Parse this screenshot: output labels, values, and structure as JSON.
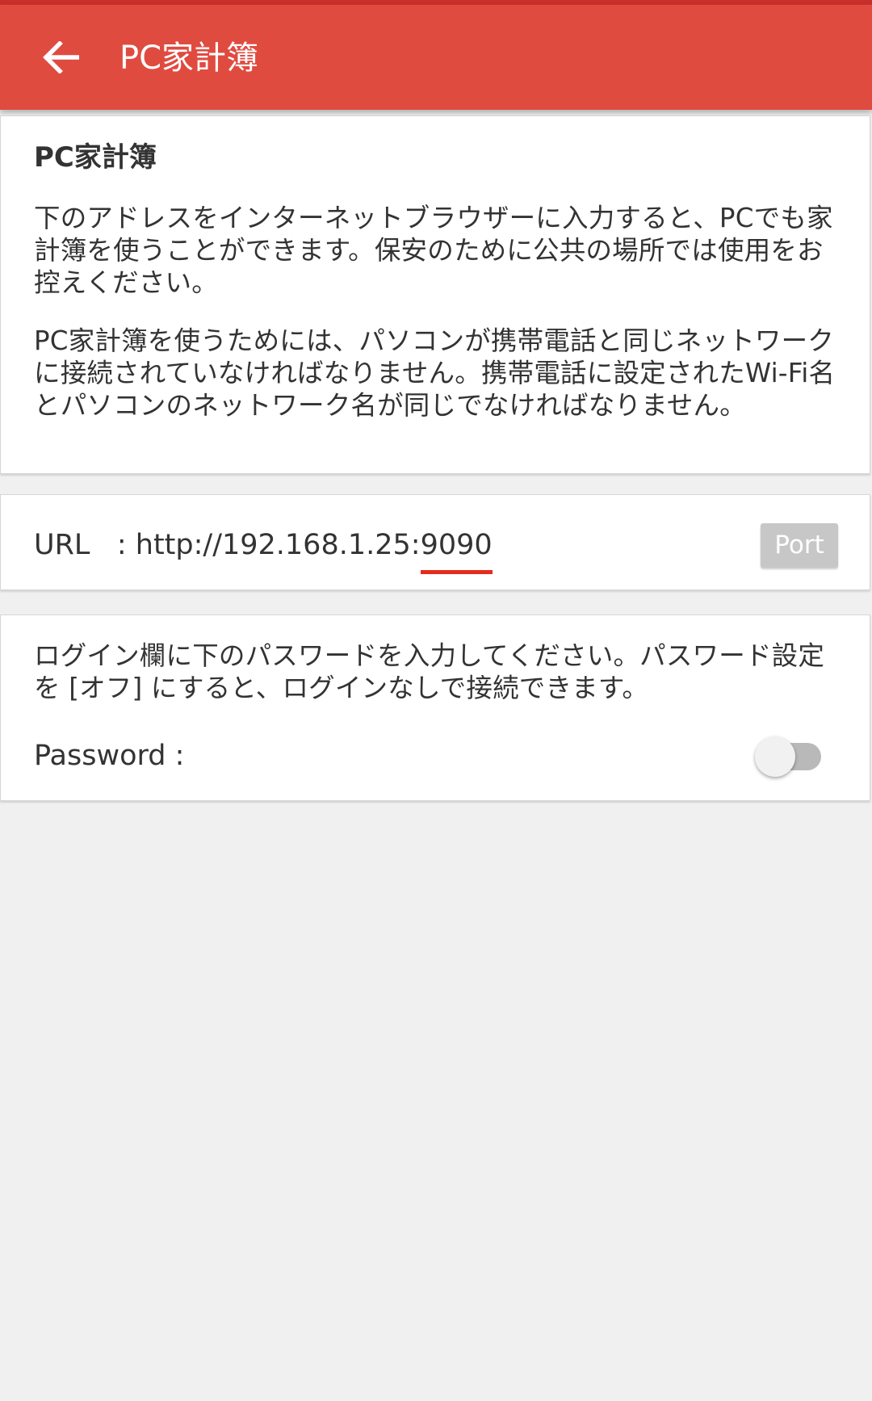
{
  "colors": {
    "appbar": "#e04b40",
    "status_strip": "#c9302b",
    "background": "#f0f0f0",
    "card": "#ffffff",
    "accent_underline": "#e62b1e",
    "port_button": "#c7c7c7",
    "toggle_track": "#b9b9b9",
    "toggle_thumb": "#f1f1f1"
  },
  "appbar": {
    "back_icon": "arrow-left-icon",
    "title": "PC家計簿"
  },
  "intro_card": {
    "title": "PC家計簿",
    "paragraph1": "下のアドレスをインターネットブラウザーに入力すると、PCでも家計簿を使うことができます。保安のために公共の場所では使用をお控えください。",
    "paragraph2": "PC家計簿を使うためには、パソコンが携帯電話と同じネットワークに接続されていなければなりません。携帯電話に設定されたWi-Fi名とパソコンのネットワーク名が同じでなければなりません。"
  },
  "url_card": {
    "label": "URL",
    "separator": ":",
    "base": "http://192.168.1.25:",
    "port": "9090",
    "port_button": "Port"
  },
  "password_card": {
    "description": "ログイン欄に下のパスワードを入力してください。パスワード設定を [オフ] にすると、ログインなしで接続できます。",
    "label": "Password :",
    "toggle_on": false
  }
}
